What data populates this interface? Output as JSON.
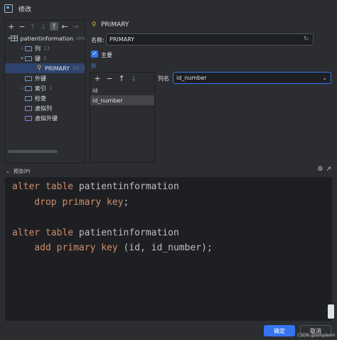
{
  "window": {
    "title": "修改"
  },
  "left_toolbar": {
    "icons": [
      "plus-icon",
      "minus-icon",
      "move-up-icon",
      "move-down-icon",
      "move-to-top-icon",
      "back-icon",
      "forward-icon"
    ]
  },
  "tree": {
    "items": [
      {
        "label": "patientinformation",
        "hint": "sim"
      },
      {
        "label": "列",
        "count": "13"
      },
      {
        "label": "键",
        "count": "1"
      },
      {
        "label": "PRIMARY",
        "hint": "(id, id_nu"
      },
      {
        "label": "外键"
      },
      {
        "label": "索引",
        "count": "1"
      },
      {
        "label": "检查"
      },
      {
        "label": "虚拟列"
      },
      {
        "label": "虚拟外键"
      }
    ]
  },
  "detail": {
    "header": "PRIMARY",
    "name_label": "名称:",
    "name_value": "PRIMARY",
    "primary_label": "主要",
    "columns_link": "列"
  },
  "columns": {
    "items": [
      "id",
      "id_number"
    ],
    "selected": "id_number",
    "column_name_label": "列名",
    "column_name_value": "id_number"
  },
  "preview": {
    "label": "预览(P)",
    "code": [
      {
        "parts": [
          {
            "t": "alter table",
            "kw": true
          },
          {
            "t": " patientinformation",
            "kw": false
          }
        ]
      },
      {
        "parts": [
          {
            "t": "    drop primary key",
            "kw": true
          },
          {
            "t": ";",
            "kw": false
          }
        ]
      },
      {
        "parts": []
      },
      {
        "parts": [
          {
            "t": "alter table",
            "kw": true
          },
          {
            "t": " patientinformation",
            "kw": false
          }
        ]
      },
      {
        "parts": [
          {
            "t": "    add primary key",
            "kw": true
          },
          {
            "t": " (id, id_number);",
            "kw": false
          }
        ]
      }
    ]
  },
  "footer": {
    "ok": "确定",
    "cancel": "取消",
    "watermark": "CSDN @simplesin"
  },
  "colors": {
    "accent": "#3574f0",
    "keyword": "#cf8e6d",
    "selection": "#2e436e",
    "key_icon": "#e3b341"
  }
}
